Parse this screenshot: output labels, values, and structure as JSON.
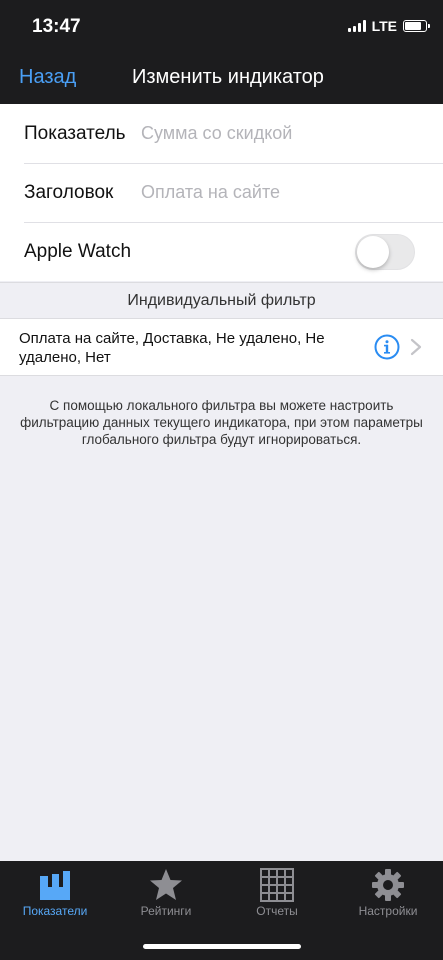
{
  "status": {
    "time": "13:47",
    "network": "LTE",
    "battery_level": 0.85
  },
  "nav": {
    "back_label": "Назад",
    "title": "Изменить индикатор"
  },
  "form": {
    "rows": [
      {
        "label": "Показатель",
        "value": "Сумма со скидкой"
      },
      {
        "label": "Заголовок",
        "value": "Оплата на сайте"
      },
      {
        "label": "Apple Watch",
        "toggle_on": false
      }
    ]
  },
  "filter": {
    "section_title": "Индивидуальный фильтр",
    "summary_line1": "Оплата на сайте, Доставка, Не удалено, Не",
    "summary_line2": "удалено, Нет",
    "info_icon": "info-icon",
    "chevron_icon": "chevron-right-icon"
  },
  "footnote": {
    "line1": "С помощью локального фильтра вы можете настроить",
    "line2": "фильтрацию данных текущего индикатора, при этом параметры",
    "line3": "глобального фильтра будут игнорироваться."
  },
  "tabbar": {
    "tabs": [
      {
        "label": "Показатели",
        "icon": "indicators-icon",
        "active": true
      },
      {
        "label": "Рейтинги",
        "icon": "star-icon",
        "active": false
      },
      {
        "label": "Отчеты",
        "icon": "grid-icon",
        "active": false
      },
      {
        "label": "Настройки",
        "icon": "gear-icon",
        "active": false
      }
    ]
  },
  "colors": {
    "accent": "#4a9ff5",
    "header_bg": "#1c1c1e",
    "background": "#efeff4"
  }
}
